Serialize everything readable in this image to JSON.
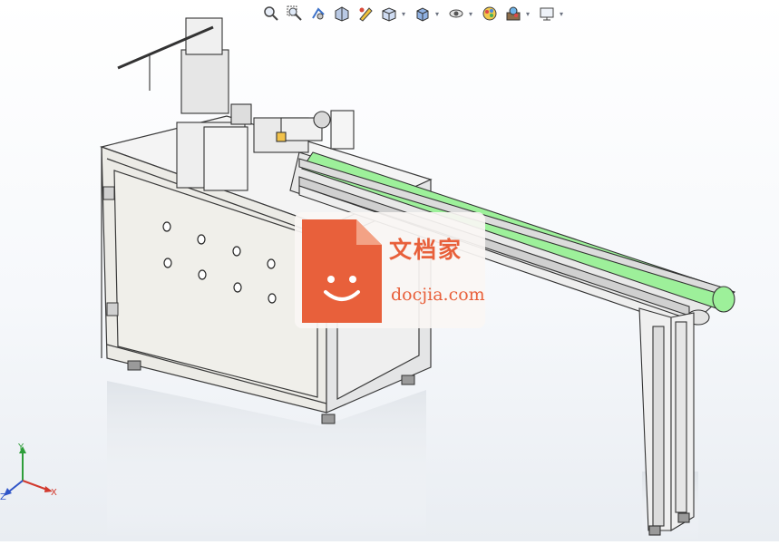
{
  "toolbar": {
    "items": [
      {
        "icon": "zoom-to-fit-icon",
        "dropdown": false
      },
      {
        "icon": "zoom-to-area-icon",
        "dropdown": false
      },
      {
        "icon": "previous-view-icon",
        "dropdown": false
      },
      {
        "icon": "section-view-icon",
        "dropdown": false
      },
      {
        "icon": "dynamic-annotation-icon",
        "dropdown": false
      },
      {
        "icon": "view-orientation-icon",
        "dropdown": true
      },
      {
        "icon": "display-style-icon",
        "dropdown": true
      },
      {
        "icon": "hide-show-items-icon",
        "dropdown": true
      },
      {
        "icon": "edit-appearance-icon",
        "dropdown": false
      },
      {
        "icon": "apply-scene-icon",
        "dropdown": true
      },
      {
        "icon": "view-settings-icon",
        "dropdown": true
      }
    ]
  },
  "triad": {
    "x_label": "X",
    "y_label": "Y",
    "z_label": "Z"
  },
  "watermark": {
    "cn": "文档家",
    "en": "docjia.com",
    "accent": "#e8603b"
  },
  "colors": {
    "belt": "#9df09a",
    "frame": "#f2f2f2",
    "panel": "#ecebe6",
    "outline": "#3a3a3a"
  }
}
